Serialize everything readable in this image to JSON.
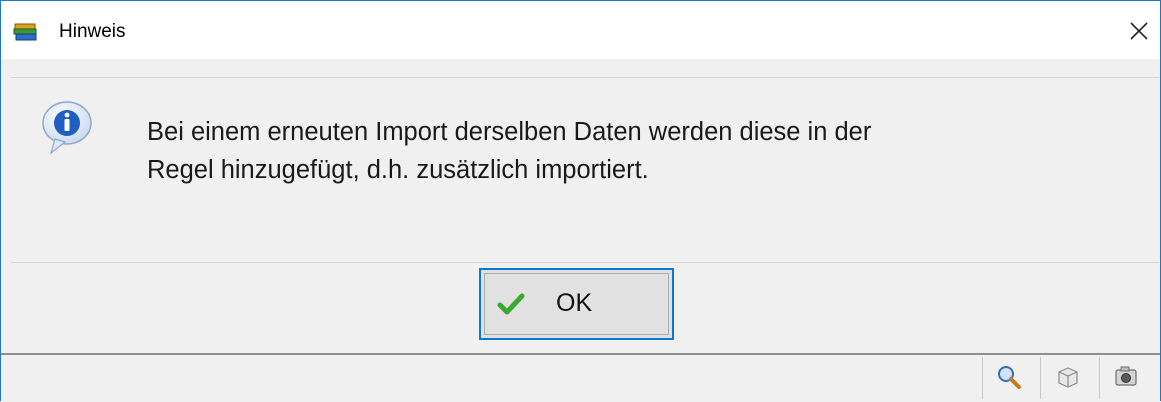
{
  "window": {
    "title": "Hinweis"
  },
  "dialog": {
    "message_line1": "Bei einem erneuten Import derselben Daten werden diese in der",
    "message_line2": "Regel hinzugefügt, d.h. zusätzlich importiert.",
    "ok_label": "OK"
  },
  "icons": {
    "app": "books-icon",
    "close": "close-icon",
    "info": "info-bubble-icon",
    "ok": "checkmark-icon",
    "statusbar": [
      "magnifier-icon",
      "box-icon",
      "camera-icon"
    ]
  },
  "colors": {
    "accent": "#0a78d7",
    "info_blue": "#1e5fc0",
    "check_green": "#3aa832"
  }
}
